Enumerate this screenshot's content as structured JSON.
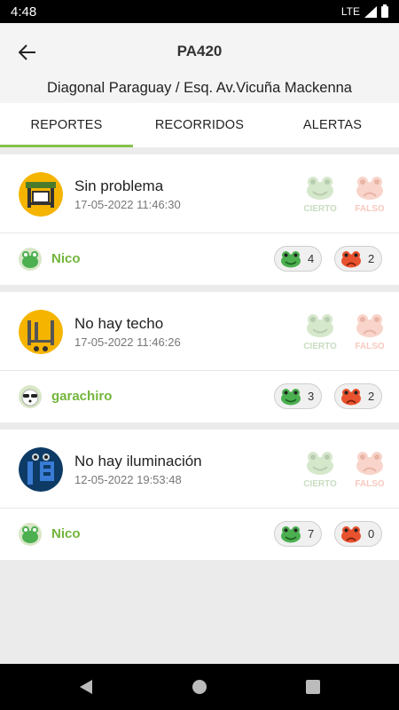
{
  "status": {
    "time": "4:48",
    "network": "LTE"
  },
  "header": {
    "title": "PA420",
    "subtitle": "Diagonal Paraguay / Esq. Av.Vicuña Mackenna"
  },
  "tabs": [
    {
      "label": "REPORTES",
      "active": true
    },
    {
      "label": "RECORRIDOS",
      "active": false
    },
    {
      "label": "ALERTAS",
      "active": false
    }
  ],
  "vote_labels": {
    "true": "CIERTO",
    "false": "FALSO"
  },
  "reports": [
    {
      "title": "Sin problema",
      "date": "17-05-2022 11:46:30",
      "user": "Nico",
      "true_count": "4",
      "false_count": "2",
      "icon": "bus-stop-ok-icon",
      "user_icon": "frog-user-icon"
    },
    {
      "title": "No hay techo",
      "date": "17-05-2022 11:46:26",
      "user": "garachiro",
      "true_count": "3",
      "false_count": "2",
      "icon": "no-roof-icon",
      "user_icon": "panda-user-icon"
    },
    {
      "title": "No hay iluminación",
      "date": "12-05-2022 19:53:48",
      "user": "Nico",
      "true_count": "7",
      "false_count": "0",
      "icon": "no-light-icon",
      "user_icon": "frog-user-icon"
    }
  ],
  "colors": {
    "accent": "#86c34b",
    "user_name": "#73b53b",
    "good_frog": "#4caf50",
    "bad_frog": "#e8522e"
  }
}
